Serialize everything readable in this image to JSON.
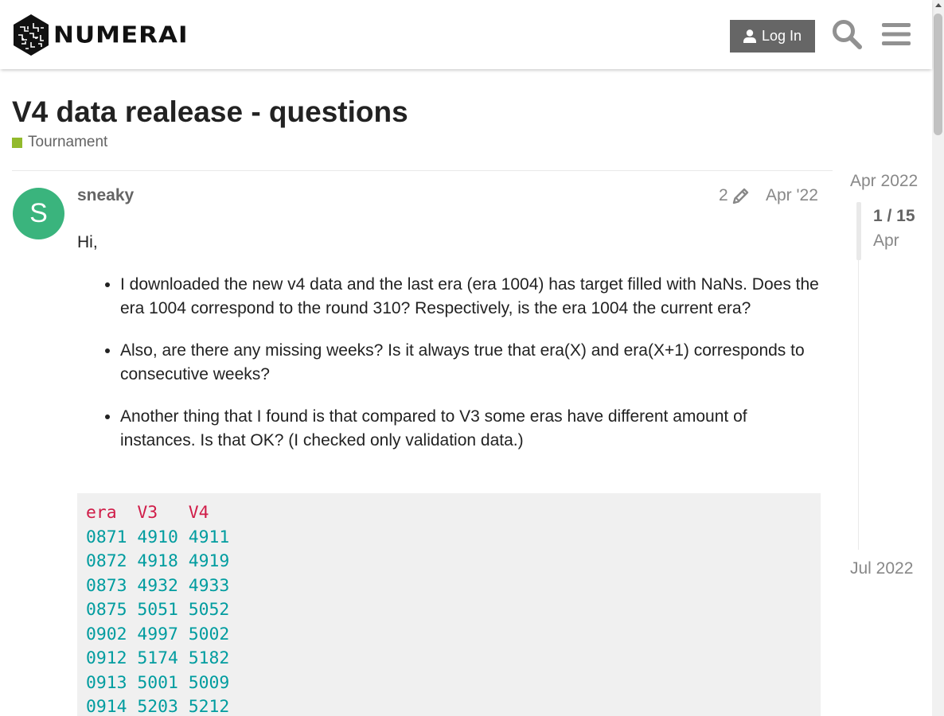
{
  "header": {
    "logo_text": "NUMERAI",
    "login_label": "Log In",
    "icons": [
      "logo-mark-icon",
      "user-icon",
      "search-icon",
      "hamburger-menu-icon"
    ]
  },
  "topic": {
    "title": "V4 data realease - questions",
    "category": "Tournament",
    "category_color": "#92ba2c"
  },
  "post": {
    "avatar_letter": "S",
    "avatar_color": "#3ab47d",
    "username": "sneaky",
    "edit_count": "2",
    "date": "Apr '22",
    "greeting": "Hi,",
    "bullets": [
      "I downloaded the new v4 data and the last era (era 1004) has target filled with NaNs. Does the era 1004 correspond to the round 310? Respectively, is the era 1004 the current era?",
      "Also, are there any missing weeks? Is it always true that era(X) and era(X+1) corresponds to consecutive weeks?",
      "Another thing that I found is that compared to V3 some eras have different amount of instances. Is that OK? (I checked only validation data.)"
    ],
    "code_header": "era  V3   V4",
    "code_rows": [
      "0871 4910 4911",
      "0872 4918 4919",
      "0873 4932 4933",
      "0875 5051 5052",
      "0902 4997 5002",
      "0912 5174 5182",
      "0913 5001 5009",
      "0914 5203 5212"
    ]
  },
  "timeline": {
    "start": "Apr 2022",
    "progress": "1 / 15",
    "current": "Apr",
    "end": "Jul 2022",
    "position_fraction": 0.0
  }
}
